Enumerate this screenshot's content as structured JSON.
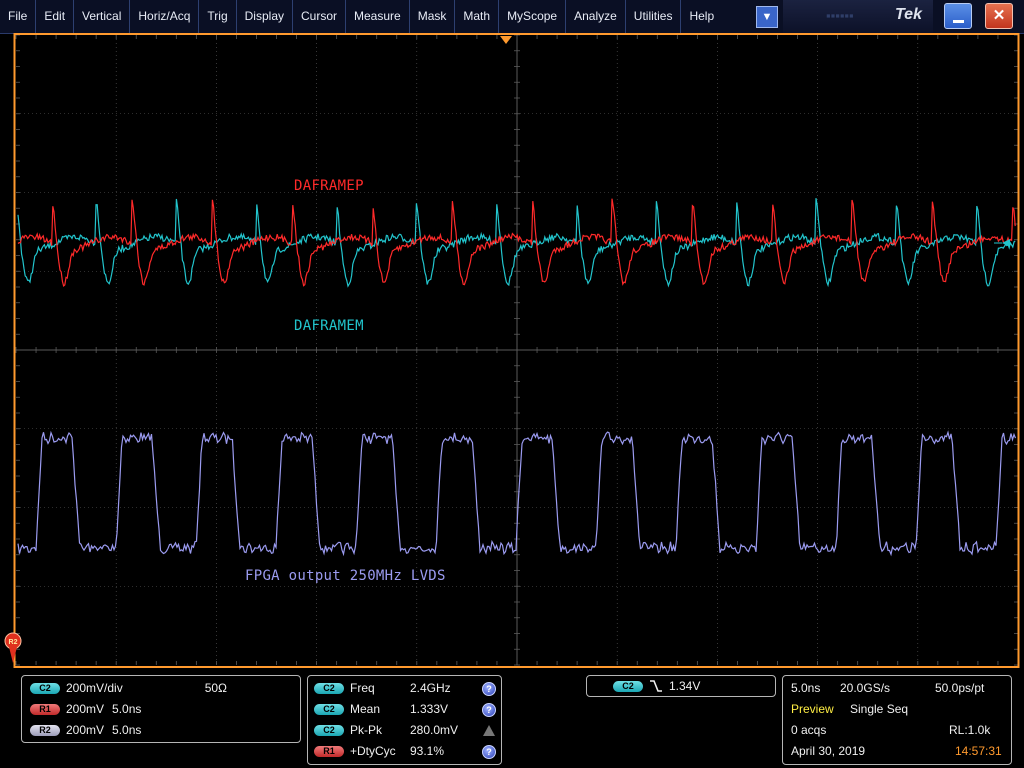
{
  "menu": {
    "items": [
      "File",
      "Edit",
      "Vertical",
      "Horiz/Acq",
      "Trig",
      "Display",
      "Cursor",
      "Measure",
      "Mask",
      "Math",
      "MyScope",
      "Analyze",
      "Utilities",
      "Help"
    ],
    "brand": "Tek"
  },
  "traces": {
    "c2_label": "DAFRAMEM",
    "r1_label": "DAFRAMEP",
    "r2_label": "FPGA output 250MHz LVDS",
    "colors": {
      "c2": "#22c4cc",
      "r1": "#ff2a2a",
      "r2": "#9b9bf0",
      "grid": "#5a5a5a",
      "frame": "#ff9a2e"
    }
  },
  "channels": {
    "c2": {
      "tag": "C2",
      "scale": "200mV/div",
      "impedance": "50Ω"
    },
    "r1": {
      "tag": "R1",
      "scale": "200mV",
      "time": "5.0ns"
    },
    "r2": {
      "tag": "R2",
      "scale": "200mV",
      "time": "5.0ns"
    }
  },
  "measurements": [
    {
      "source": "C2",
      "name": "Freq",
      "value": "2.4GHz",
      "status": "info"
    },
    {
      "source": "C2",
      "name": "Mean",
      "value": "1.333V",
      "status": "info"
    },
    {
      "source": "C2",
      "name": "Pk-Pk",
      "value": "280.0mV",
      "status": "warning"
    },
    {
      "source": "R1",
      "name": "+DtyCyc",
      "value": "93.1%",
      "status": "info"
    }
  ],
  "trigger": {
    "source": "C2",
    "slope": "falling",
    "level": "1.34V"
  },
  "acquisition": {
    "timebase": "5.0ns",
    "sample_rate": "20.0GS/s",
    "resolution": "50.0ps/pt",
    "mode_status": "Preview",
    "mode": "Single Seq",
    "acqs": "0 acqs",
    "record_length": "RL:1.0k",
    "date": "April 30, 2019",
    "time": "14:57:31"
  },
  "ground_marker": "R2"
}
